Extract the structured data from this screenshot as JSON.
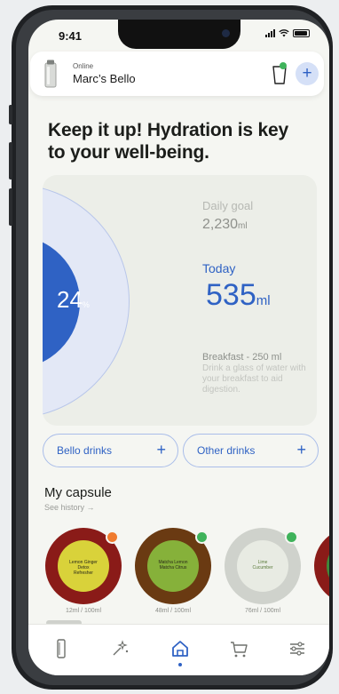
{
  "status_bar": {
    "time": "9:41"
  },
  "header": {
    "status": "Online",
    "device_name": "Marc’s Bello",
    "add_symbol": "+"
  },
  "headline": "Keep it up! Hydration is key to your well-being.",
  "progress": {
    "percent_value": "24",
    "percent_symbol": "%",
    "fraction": 0.24
  },
  "daily_goal": {
    "label": "Daily goal",
    "value": "2,230",
    "unit": "ml"
  },
  "today": {
    "label": "Today",
    "value": "535",
    "unit": "ml"
  },
  "suggestion": {
    "title": "Breakfast - 250 ml",
    "text": "Drink a glass of water with your breakfast to aid digestion."
  },
  "drink_buttons": [
    {
      "label": "Bello drinks",
      "symbol": "+"
    },
    {
      "label": "Other drinks",
      "symbol": "+"
    }
  ],
  "capsules_section": {
    "title": "My capsule",
    "see_history": "See history →",
    "items": [
      {
        "label": "Lemon Ginger Detox Refresher",
        "volume": "12ml / 100ml",
        "ring_color": "#8a1b18",
        "core_color": "#d9d23a",
        "dot_color": "#f07b2f"
      },
      {
        "label": "Matcha Lemon Matcha Citrus",
        "volume": "48ml / 100ml",
        "ring_color": "#6a3a12",
        "core_color": "#86b13a",
        "dot_color": "#3fb35b"
      },
      {
        "label": "Lime Cucumber",
        "volume": "76ml / 100ml",
        "ring_color": "#cfd2cc",
        "core_color": "#e8ebe3",
        "dot_color": "#3fb35b"
      }
    ]
  },
  "nav": [
    {
      "name": "device",
      "icon": "bottle-icon"
    },
    {
      "name": "discover",
      "icon": "sparkle-icon"
    },
    {
      "name": "home",
      "icon": "home-icon",
      "active": true
    },
    {
      "name": "shop",
      "icon": "cart-icon"
    },
    {
      "name": "settings",
      "icon": "sliders-icon"
    }
  ],
  "colors": {
    "accent": "#2f62c4",
    "ring_light": "#e3e8f6",
    "background": "#f5f6f2"
  }
}
